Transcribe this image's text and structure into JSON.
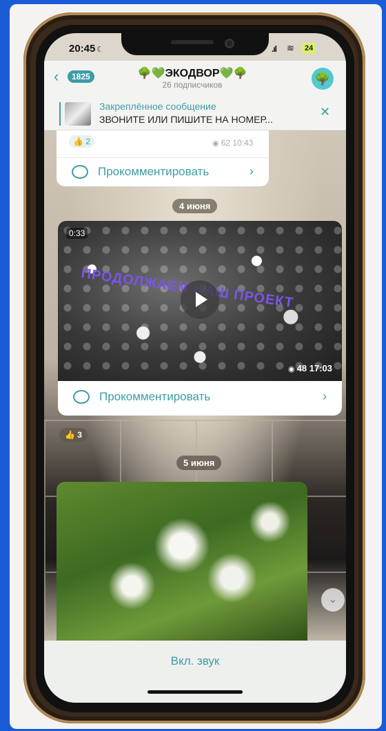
{
  "status": {
    "time": "20:45",
    "battery": "24"
  },
  "header": {
    "back_count": "1825",
    "title": "🌳💚ЭКОДВОР💚🌳",
    "subtitle": "26 подписчиков"
  },
  "pinned": {
    "title": "Закреплённое сообщение",
    "text": "ЗВОНИТЕ ИЛИ ПИШИТЕ НА НОМЕР..."
  },
  "posts": [
    {
      "reaction_count": "2",
      "views": "62",
      "time": "10:43",
      "comment_label": "Прокомментировать"
    },
    {
      "date": "4 июня",
      "duration": "0:33",
      "overlay_text": "ПРОДОЛЖАЕМ НАШ ПРОЕКТ",
      "views": "48",
      "time": "17:03",
      "comment_label": "Прокомментировать",
      "reaction_count": "3"
    },
    {
      "date": "5 июня"
    }
  ],
  "footer": {
    "sound_label": "Вкл. звук"
  },
  "colors": {
    "accent": "#3d9ca6",
    "overlay_text": "#7a55e6",
    "battery": "#d9f06a"
  }
}
